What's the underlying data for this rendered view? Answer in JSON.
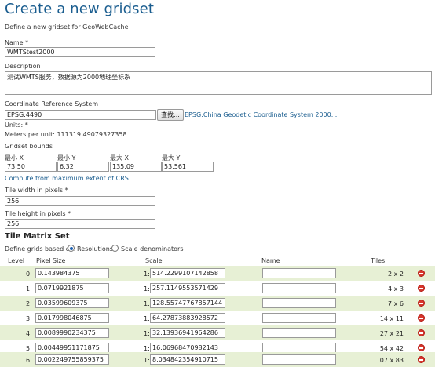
{
  "page": {
    "title": "Create a new gridset",
    "subtitle": "Define a new gridset for GeoWebCache"
  },
  "form": {
    "name_label": "Name *",
    "name_value": "WMTStest2000",
    "description_label": "Description",
    "description_value": "测试WMTS服务，数据源为2000地理坐标系",
    "crs_label": "Coordinate Reference System",
    "crs_value": "EPSG:4490",
    "find_button": "查找...",
    "crs_link": "EPSG:China Geodetic Coordinate System 2000...",
    "units_label": "Units: *",
    "meters_per_unit": "Meters per unit: 111319.49079327358",
    "bounds_label": "Gridset bounds",
    "bounds": [
      {
        "label": "最小 X",
        "value": "73.50"
      },
      {
        "label": "最小 Y",
        "value": "6.32"
      },
      {
        "label": "最大 X",
        "value": "135.09"
      },
      {
        "label": "最大 Y",
        "value": "53.561"
      }
    ],
    "compute_link": "Compute from maximum extent of CRS",
    "tile_width_label": "Tile width in pixels *",
    "tile_width_value": "256",
    "tile_height_label": "Tile height in pixels *",
    "tile_height_value": "256"
  },
  "matrix": {
    "section_title": "Tile Matrix Set",
    "define_label": "Define grids based on:",
    "option_resolutions": "Resolutions",
    "option_scale": "Scale denominators",
    "selected_option": "Resolutions",
    "headers": {
      "level": "Level",
      "pixel_size": "Pixel Size",
      "scale": "Scale",
      "name": "Name",
      "tiles": "Tiles"
    },
    "scale_prefix": "1:",
    "rows": [
      {
        "level": "0",
        "pixel_size": "0.143984375",
        "scale": "514.2299107142858",
        "name": "",
        "tiles": "2 x 2"
      },
      {
        "level": "1",
        "pixel_size": "0.0719921875",
        "scale": "257.1149553571429",
        "name": "",
        "tiles": "4 x 3"
      },
      {
        "level": "2",
        "pixel_size": "0.03599609375",
        "scale": "128.55747767857144",
        "name": "",
        "tiles": "7 x 6"
      },
      {
        "level": "3",
        "pixel_size": "0.017998046875",
        "scale": "64.27873883928572",
        "name": "",
        "tiles": "14 x 11"
      },
      {
        "level": "4",
        "pixel_size": "0.0089990234375",
        "scale": "32.13936941964286",
        "name": "",
        "tiles": "27 x 21"
      },
      {
        "level": "5",
        "pixel_size": "0.00449951171875",
        "scale": "16.06968470982143",
        "name": "",
        "tiles": "54 x 42"
      },
      {
        "level": "6",
        "pixel_size": "0.002249755859375",
        "scale": "8.034842354910715",
        "name": "",
        "tiles": "107 x 83"
      }
    ]
  },
  "colors": {
    "accent": "#1a5d8f",
    "row_highlight": "#e7f0d5",
    "remove": "#d9362c"
  },
  "icons": {
    "remove": "remove-icon"
  }
}
